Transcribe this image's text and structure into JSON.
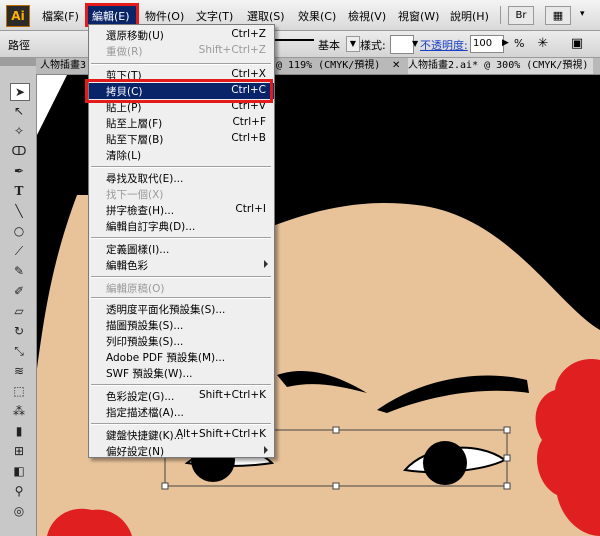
{
  "app": {
    "logo": "Ai",
    "brand_color": "#ff9a00"
  },
  "menubar": {
    "items": [
      "檔案(F)",
      "編輯(E)",
      "物件(O)",
      "文字(T)",
      "選取(S)",
      "效果(C)",
      "檢視(V)",
      "視窗(W)",
      "說明(H)"
    ],
    "bridge_label": "Br",
    "highlight_color": "#0a246a",
    "annotation_color": "#e41b1b"
  },
  "control_bar": {
    "path_label": "路徑",
    "stroke_basic": "基本",
    "style_label": "樣式:",
    "opacity_label": "不透明度:",
    "opacity_value": "100",
    "opacity_unit": "%"
  },
  "tabs": [
    {
      "label": "人物插畫3"
    },
    {
      "label": "@ 119% (CMYK/預視)"
    },
    {
      "label": "人物插畫2.ai* @ 300% (CMYK/預視)"
    }
  ],
  "toolbox": {
    "tools": [
      "selection-arrow",
      "direct-selection",
      "magic-wand",
      "lasso",
      "pen",
      "type",
      "line",
      "ellipse",
      "paintbrush",
      "pencil",
      "blob-brush",
      "eraser",
      "rotate",
      "scale",
      "warp",
      "free-transform",
      "symbol-sprayer",
      "graph",
      "mesh",
      "gradient",
      "eyedropper",
      "blend"
    ]
  },
  "edit_menu": {
    "items": [
      {
        "label": "還原移動(U)",
        "shortcut": "Ctrl+Z",
        "disabled": false
      },
      {
        "label": "重做(R)",
        "shortcut": "Shift+Ctrl+Z",
        "disabled": true
      },
      {
        "label": "剪下(T)",
        "shortcut": "Ctrl+X",
        "disabled": false
      },
      {
        "label": "拷貝(C)",
        "shortcut": "Ctrl+C",
        "selected": true
      },
      {
        "label": "貼上(P)",
        "shortcut": "Ctrl+V"
      },
      {
        "label": "貼至上層(F)",
        "shortcut": "Ctrl+F"
      },
      {
        "label": "貼至下層(B)",
        "shortcut": "Ctrl+B"
      },
      {
        "label": "清除(L)",
        "shortcut": ""
      },
      {
        "label": "尋找及取代(E)...",
        "shortcut": ""
      },
      {
        "label": "找下一個(X)",
        "shortcut": "",
        "disabled": true
      },
      {
        "label": "拼字檢查(H)...",
        "shortcut": "Ctrl+I"
      },
      {
        "label": "編輯自訂字典(D)...",
        "shortcut": ""
      },
      {
        "label": "定義圖樣(I)...",
        "shortcut": ""
      },
      {
        "label": "編輯色彩",
        "shortcut": "",
        "submenu": true
      },
      {
        "label": "編輯原稿(O)",
        "shortcut": "",
        "disabled": true
      },
      {
        "label": "透明度平面化預設集(S)...",
        "shortcut": ""
      },
      {
        "label": "描圖預設集(S)...",
        "shortcut": ""
      },
      {
        "label": "列印預設集(S)...",
        "shortcut": ""
      },
      {
        "label": "Adobe PDF 預設集(M)...",
        "shortcut": ""
      },
      {
        "label": "SWF 預設集(W)...",
        "shortcut": ""
      },
      {
        "label": "色彩設定(G)...",
        "shortcut": "Shift+Ctrl+K"
      },
      {
        "label": "指定描述檔(A)...",
        "shortcut": ""
      },
      {
        "label": "鍵盤快捷鍵(K)...",
        "shortcut": "Alt+Shift+Ctrl+K"
      },
      {
        "label": "偏好設定(N)",
        "shortcut": "",
        "submenu": true
      }
    ]
  },
  "artwork": {
    "skin_color": "#e8c39a",
    "hair_color": "#000000",
    "accent_color": "#e02020"
  }
}
